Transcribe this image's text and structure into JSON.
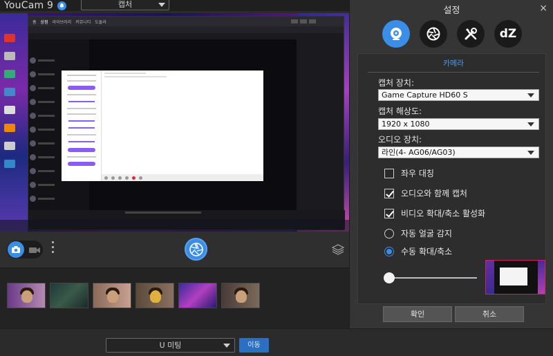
{
  "app": {
    "title": "YouCam 9"
  },
  "topbar": {
    "mode_value": "캡처"
  },
  "bottom": {
    "meeting_value": "U 미팅",
    "go_label": "이동"
  },
  "settings": {
    "title": "설정",
    "close": "×",
    "tabs": [
      {
        "id": "camera",
        "icon": "webcam-icon",
        "active": true
      },
      {
        "id": "effects",
        "icon": "aperture-icon",
        "active": false
      },
      {
        "id": "tools",
        "icon": "tools-icon",
        "active": false
      },
      {
        "id": "dz",
        "label": "dZ",
        "icon": "dz-icon",
        "active": false
      }
    ],
    "section": "카메라",
    "capture_device_label": "캡처 장치:",
    "capture_device_value": "Game Capture HD60 S",
    "resolution_label": "캡처 해상도:",
    "resolution_value": "1920 x 1080",
    "audio_device_label": "오디오 장치:",
    "audio_device_value": "라인(4- AG06/AG03)",
    "options": {
      "mirror": {
        "label": "좌우 대칭",
        "checked": false
      },
      "capture_audio": {
        "label": "오디오와 함께 캡처",
        "checked": true
      },
      "video_zoom": {
        "label": "비디오 확대/축소 활성화",
        "checked": true
      },
      "auto_face": {
        "label": "자동 얼굴 감지",
        "selected": false
      },
      "manual_zoom": {
        "label": "수동 확대/축소",
        "selected": true
      }
    },
    "zoom_level": 0,
    "ok_label": "확인",
    "cancel_label": "취소"
  },
  "preview": {
    "browser_breadcrumb": [
      "홈",
      "상점",
      "라이브러리",
      "커뮤니티",
      "도둘라"
    ]
  },
  "colors": {
    "accent": "#3a8ee8",
    "panel": "#353535",
    "highlight": "#d02060"
  }
}
